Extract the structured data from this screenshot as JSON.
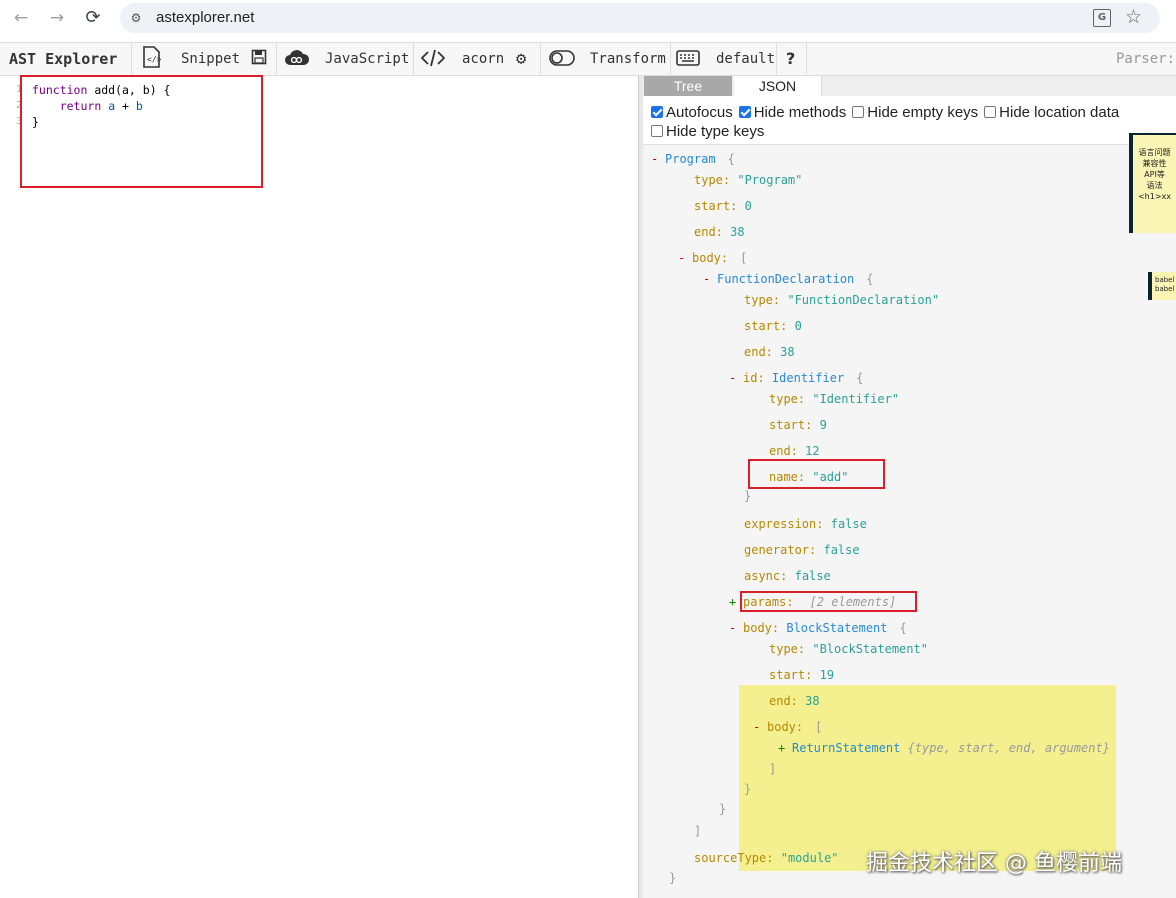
{
  "browser": {
    "back": "←",
    "forward": "→",
    "reload": "⟳",
    "url": "astexplorer.net",
    "translate_glyph": "G",
    "star_glyph": "☆"
  },
  "toolbar": {
    "brand": "AST Explorer",
    "snippet": "Snippet",
    "language": "JavaScript",
    "parser": "acorn",
    "transform": "Transform",
    "keymap": "default",
    "help": "?",
    "parser_label": "Parser:"
  },
  "editor": {
    "line_numbers": [
      "1",
      "2",
      "3"
    ],
    "lines": [
      [
        {
          "t": "kw",
          "v": "function"
        },
        {
          "t": "plain",
          "v": " add(a, b) {"
        }
      ],
      [
        {
          "t": "plain",
          "v": "    "
        },
        {
          "t": "kw",
          "v": "return"
        },
        {
          "t": "plain",
          "v": " "
        },
        {
          "t": "var",
          "v": "a"
        },
        {
          "t": "plain",
          "v": " + "
        },
        {
          "t": "var",
          "v": "b"
        }
      ],
      [
        {
          "t": "plain",
          "v": "}"
        }
      ]
    ]
  },
  "output": {
    "tabs": [
      "Tree",
      "JSON"
    ],
    "options": [
      {
        "label": "Autofocus",
        "checked": true
      },
      {
        "label": "Hide methods",
        "checked": true
      },
      {
        "label": "Hide empty keys",
        "checked": false
      },
      {
        "label": "Hide location data",
        "checked": false
      },
      {
        "label": "Hide type keys",
        "checked": false
      }
    ]
  },
  "tree": {
    "program": {
      "toggle": "-",
      "name": "Program",
      "brace": "{"
    },
    "program_type": {
      "key": "type:",
      "value": "\"Program\""
    },
    "program_start": {
      "key": "start:",
      "value": "0"
    },
    "program_end": {
      "key": "end:",
      "value": "38"
    },
    "program_body": {
      "toggle": "-",
      "key": "body:",
      "brace": "["
    },
    "fn": {
      "toggle": "-",
      "name": "FunctionDeclaration",
      "brace": "{"
    },
    "fn_type": {
      "key": "type:",
      "value": "\"FunctionDeclaration\""
    },
    "fn_start": {
      "key": "start:",
      "value": "0"
    },
    "fn_end": {
      "key": "end:",
      "value": "38"
    },
    "fn_id": {
      "toggle": "-",
      "key": "id:",
      "name": "Identifier",
      "brace": "{"
    },
    "id_type": {
      "key": "type:",
      "value": "\"Identifier\""
    },
    "id_start": {
      "key": "start:",
      "value": "9"
    },
    "id_end": {
      "key": "end:",
      "value": "12"
    },
    "id_name": {
      "key": "name:",
      "value": "\"add\""
    },
    "id_close": "}",
    "fn_expression": {
      "key": "expression:",
      "value": "false"
    },
    "fn_generator": {
      "key": "generator:",
      "value": "false"
    },
    "fn_async": {
      "key": "async:",
      "value": "false"
    },
    "fn_params": {
      "toggle": "+",
      "key": "params:",
      "summary": "[2 elements]"
    },
    "fn_body": {
      "toggle": "-",
      "key": "body:",
      "name": "BlockStatement",
      "brace": "{"
    },
    "block_type": {
      "key": "type:",
      "value": "\"BlockStatement\""
    },
    "block_start": {
      "key": "start:",
      "value": "19"
    },
    "block_end": {
      "key": "end:",
      "value": "38"
    },
    "block_body": {
      "toggle": "-",
      "key": "body:",
      "brace": "["
    },
    "ret": {
      "toggle": "+",
      "name": "ReturnStatement",
      "summary": "{type, start, end, argument}"
    },
    "block_body_close": "]",
    "block_close": "}",
    "fn_close": "}",
    "program_body_close": "]",
    "source_type": {
      "key": "sourceType:",
      "value": "\"module\""
    },
    "program_close": "}"
  },
  "float_card": {
    "lines": [
      "语言问题",
      "兼容性",
      "API等",
      "语法",
      "<h1>xx"
    ]
  },
  "float_mini": {
    "lines": [
      "babel",
      "babel"
    ]
  },
  "watermark": "掘金技术社区 @ 鱼樱前端"
}
